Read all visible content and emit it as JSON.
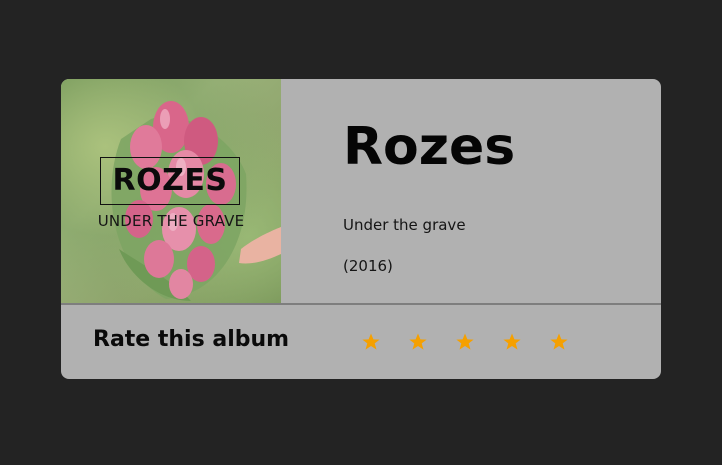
{
  "card": {
    "cover": {
      "title": "ROZES",
      "subtitle": "UNDER THE GRAVE"
    },
    "info": {
      "artist": "Rozes",
      "album": "Under the grave",
      "year": "(2016)"
    },
    "rating": {
      "label": "Rate this album",
      "star_count": 5,
      "star_color": "#f5a000"
    }
  },
  "colors": {
    "background": "#232323",
    "card": "#b1b1b1",
    "divider": "#7e7e7e"
  }
}
